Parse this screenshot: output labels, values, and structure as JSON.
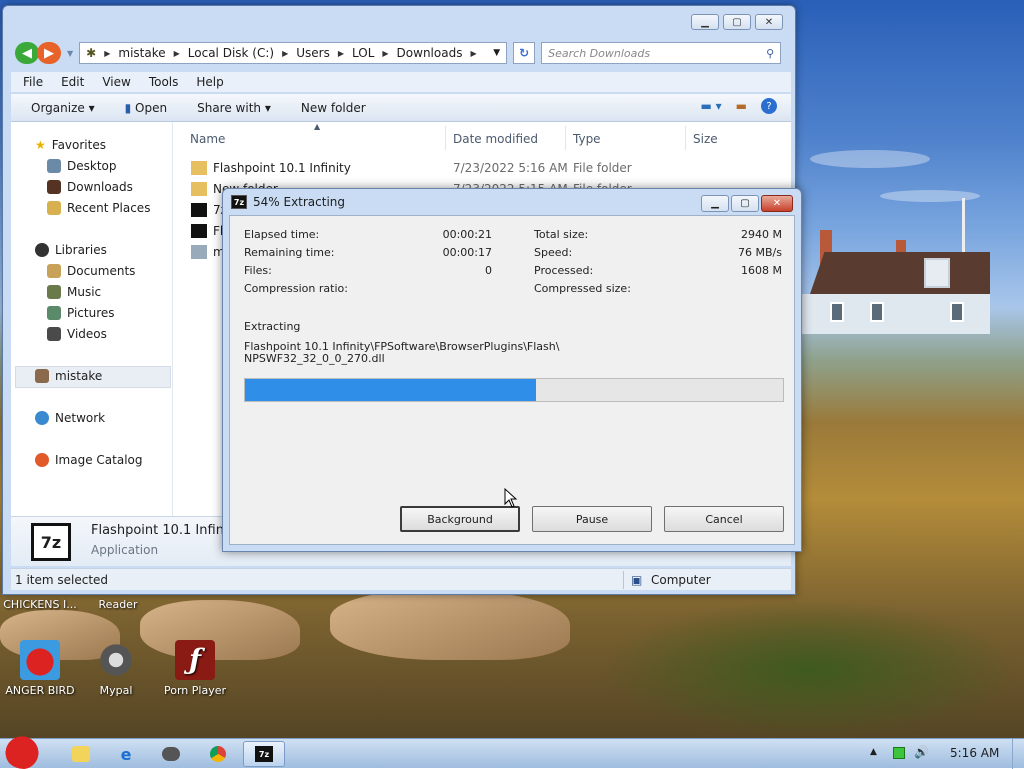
{
  "explorer": {
    "address": [
      "mistake",
      "Local Disk (C:)",
      "Users",
      "LOL",
      "Downloads"
    ],
    "search_placeholder": "Search Downloads",
    "menu": [
      "File",
      "Edit",
      "View",
      "Tools",
      "Help"
    ],
    "commands": {
      "organize": "Organize",
      "open": "Open",
      "share": "Share with",
      "new_folder": "New folder"
    },
    "nav": {
      "favorites": "Favorites",
      "desktop": "Desktop",
      "downloads": "Downloads",
      "recent": "Recent Places",
      "libraries": "Libraries",
      "documents": "Documents",
      "music": "Music",
      "pictures": "Pictures",
      "videos": "Videos",
      "user": "mistake",
      "network": "Network",
      "catalog": "Image Catalog"
    },
    "columns": {
      "name": "Name",
      "date": "Date modified",
      "type": "Type",
      "size": "Size"
    },
    "files": [
      {
        "name": "Flashpoint 10.1 Infinity",
        "date": "7/23/2022 5:16 AM",
        "type": "File folder"
      },
      {
        "name": "New folder",
        "date": "7/23/2022 5:15 AM",
        "type": "File folder"
      },
      {
        "name": "7z"
      },
      {
        "name": "Fla"
      },
      {
        "name": "my"
      }
    ],
    "details": {
      "name": "Flashpoint 10.1 Infinity.7z",
      "type": "Application"
    },
    "status": {
      "selected": "1 item selected",
      "location": "Computer"
    }
  },
  "dialog": {
    "title": "54% Extracting",
    "labels": {
      "elapsed": "Elapsed time:",
      "remaining": "Remaining time:",
      "files": "Files:",
      "ratio": "Compression ratio:",
      "total": "Total size:",
      "speed": "Speed:",
      "processed": "Processed:",
      "compressed": "Compressed size:"
    },
    "values": {
      "elapsed": "00:00:21",
      "remaining": "00:00:17",
      "files": "0",
      "total": "2940 M",
      "speed": "76 MB/s",
      "processed": "1608 M"
    },
    "extracting_label": "Extracting",
    "path_line1": "Flashpoint 10.1 Infinity\\FPSoftware\\BrowserPlugins\\Flash\\",
    "path_line2": "NPSWF32_32_0_0_270.dll",
    "progress_percent": 54,
    "buttons": {
      "background": "Background",
      "pause": "Pause",
      "cancel": "Cancel"
    }
  },
  "desktop_icons": {
    "chickens": "CHICKENS I...",
    "reader": "Reader",
    "angry": "ANGER BIRD",
    "mypal": "Mypal",
    "porn": "Porn Player"
  },
  "taskbar": {
    "clock": "5:16 AM"
  },
  "colors": {
    "accent": "#2f8fe8",
    "back_arrow": "#3aa93a",
    "forward_arrow": "#e8632a"
  }
}
